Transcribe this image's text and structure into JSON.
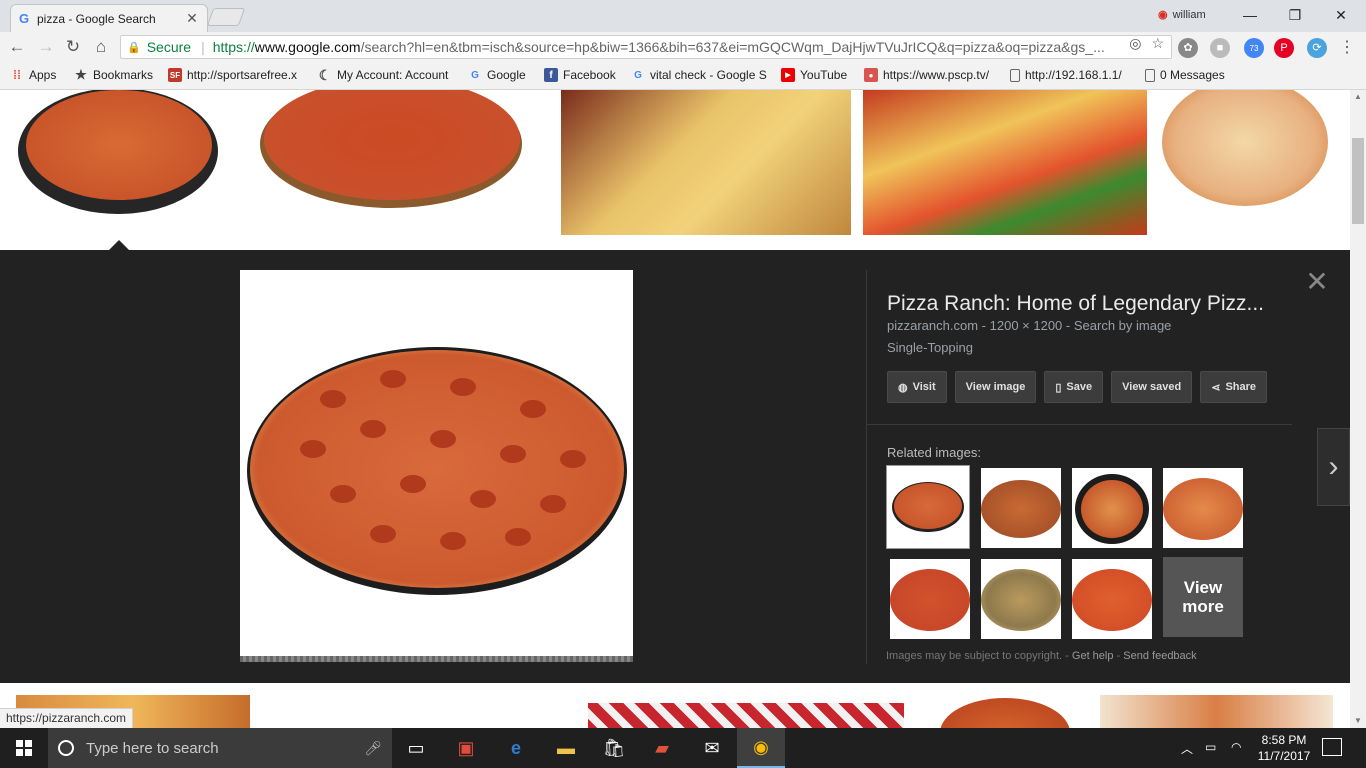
{
  "browser": {
    "tab_title": "pizza - Google Search",
    "profile_name": "william",
    "secure_label": "Secure",
    "url_proto": "https://",
    "url_host": "www.google.com",
    "url_rest": "/search?hl=en&tbm=isch&source=hp&biw=1366&bih=637&ei=mGQCWqm_DajHjwTVuJrICQ&q=pizza&oq=pizza&gs_...",
    "extension_badge": "73"
  },
  "bookmarks": [
    {
      "label": "Apps",
      "icon": "apps-grid-icon"
    },
    {
      "label": "Bookmarks",
      "icon": "star-icon"
    },
    {
      "label": "http://sportsarefree.x",
      "icon": "sf-icon"
    },
    {
      "label": "My Account: Account",
      "icon": "crescent-icon"
    },
    {
      "label": "Google",
      "icon": "google-icon"
    },
    {
      "label": "Facebook",
      "icon": "facebook-icon"
    },
    {
      "label": "vital check - Google S",
      "icon": "google-icon"
    },
    {
      "label": "YouTube",
      "icon": "youtube-icon"
    },
    {
      "label": "https://www.pscp.tv/",
      "icon": "periscope-icon"
    },
    {
      "label": "http://192.168.1.1/",
      "icon": "page-icon"
    },
    {
      "label": "0 Messages",
      "icon": "page-icon"
    }
  ],
  "preview": {
    "title": "Pizza Ranch: Home of Legendary Pizz...",
    "source": "pizzaranch.com",
    "dimensions": "1200 × 1200",
    "search_by_image": "Search by image",
    "subtitle": "Single-Topping",
    "actions": [
      "Visit",
      "View image",
      "Save",
      "View saved",
      "Share"
    ],
    "related_label": "Related images:",
    "view_more": "View more",
    "copyright": "Images may be subject to copyright.",
    "get_help": "Get help",
    "send_feedback": "Send feedback"
  },
  "status_url": "https://pizzaranch.com",
  "taskbar": {
    "search_placeholder": "Type here to search",
    "time": "8:58 PM",
    "date": "11/7/2017"
  },
  "colors": {
    "panel_bg": "#222222",
    "secure_green": "#0b8043",
    "pepperoni": "#b23a1c"
  }
}
